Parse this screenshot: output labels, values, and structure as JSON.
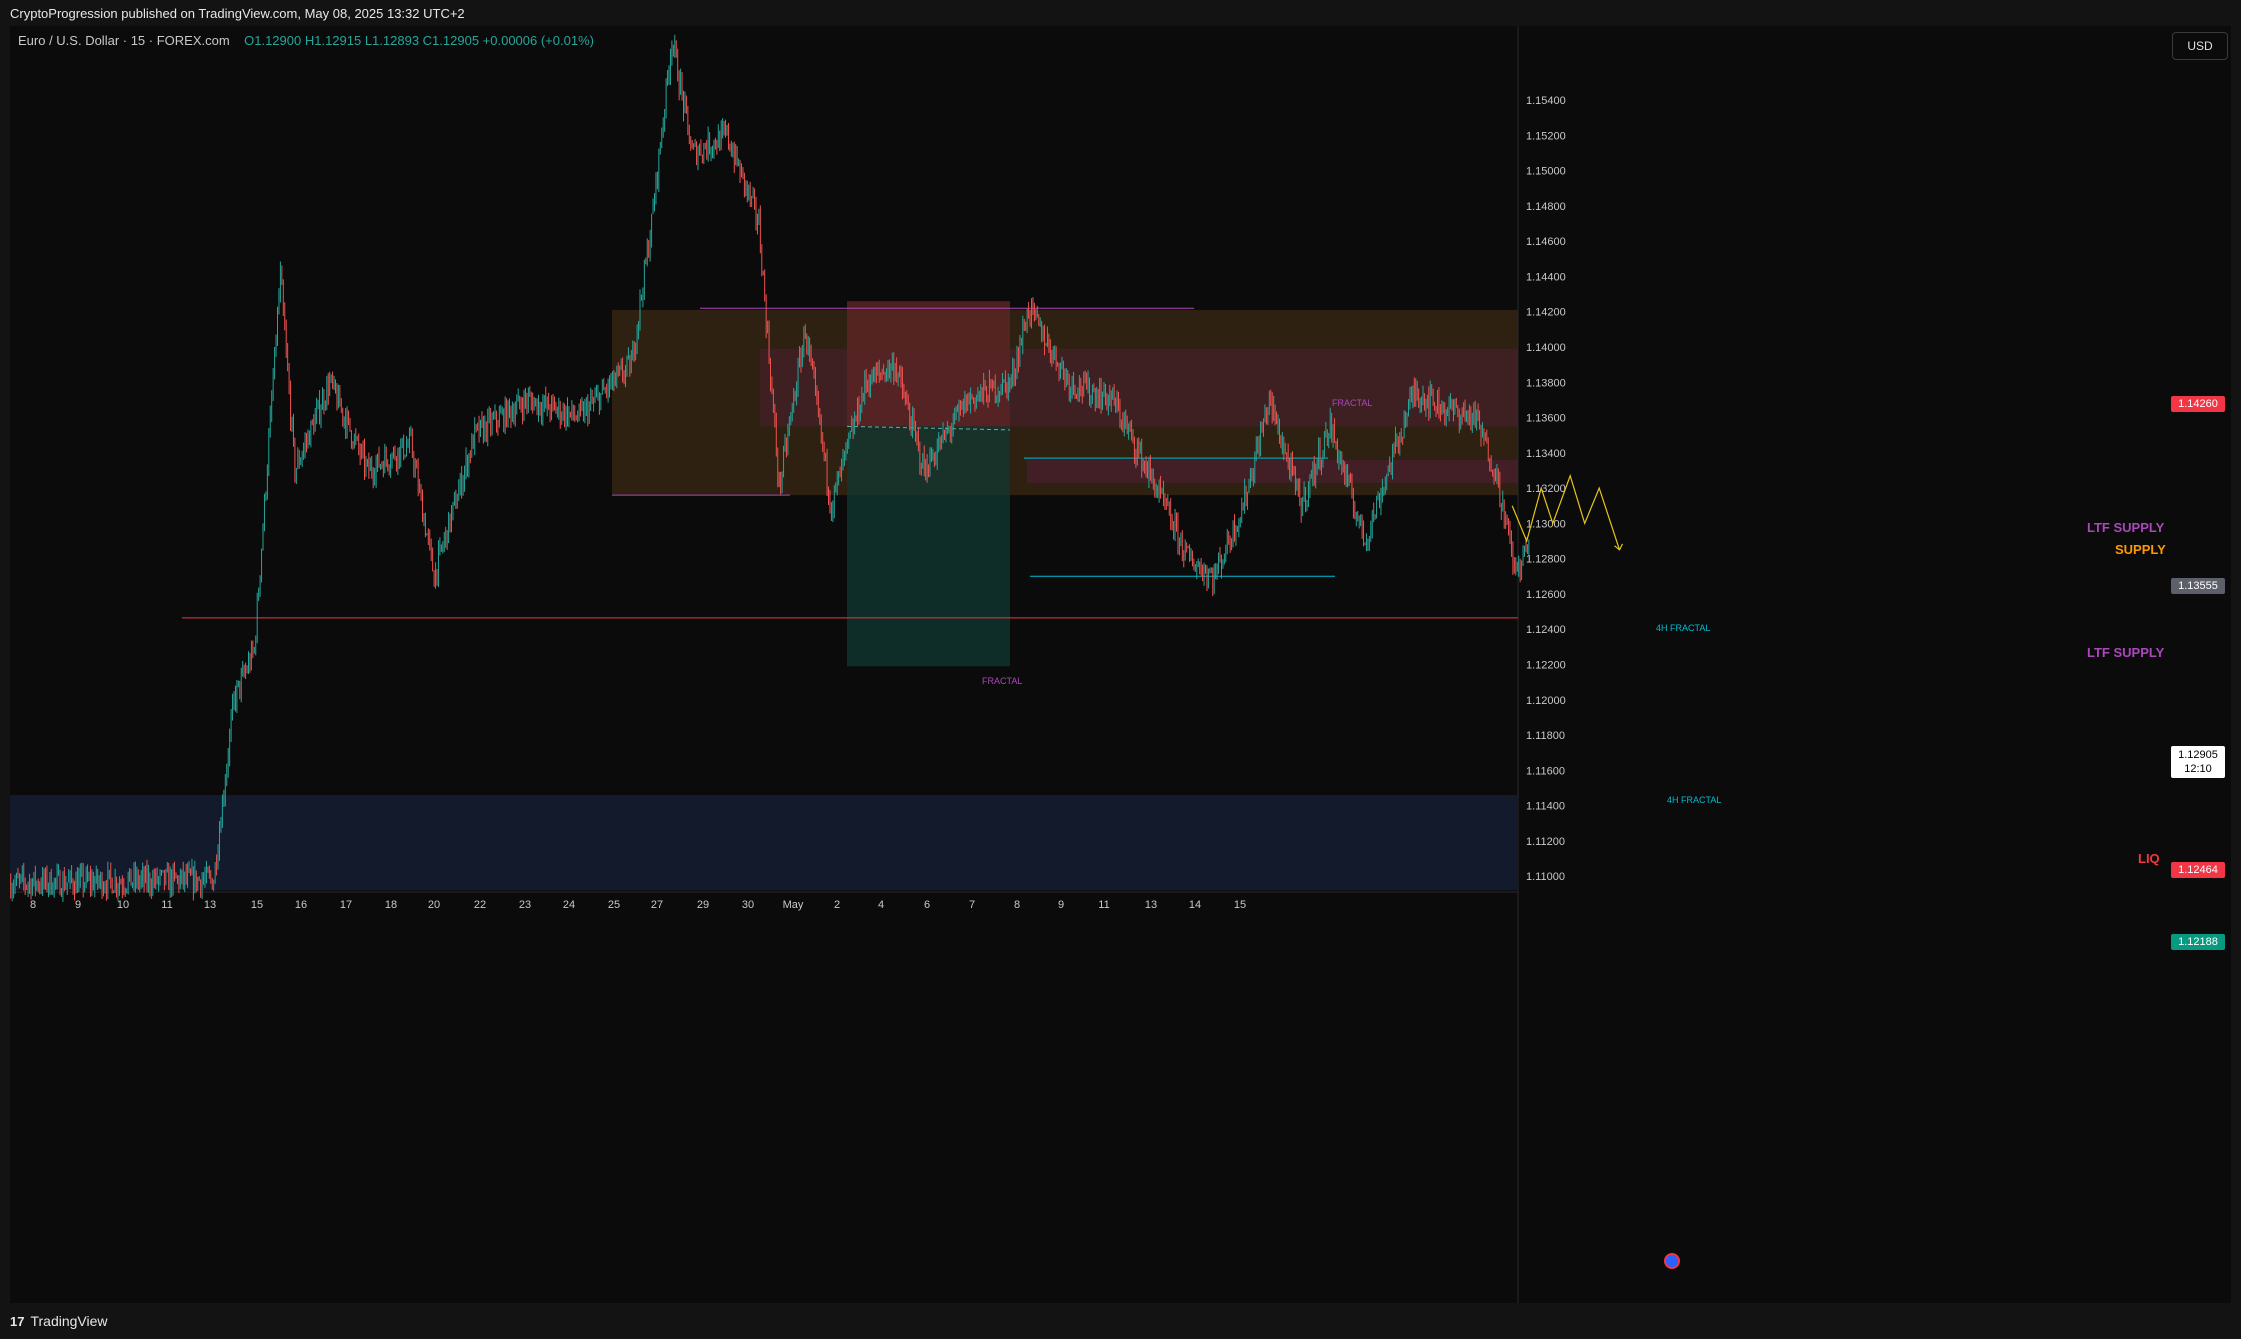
{
  "publish_bar": {
    "text": "CryptoProgression published on TradingView.com, May 08, 2025 13:32 UTC+2"
  },
  "symbol": {
    "name": "Euro / U.S. Dollar · 15 · FOREX.com",
    "ohlc": "O1.12900 H1.12915 L1.12893 C1.12905 +0.00006 (+0.01%)"
  },
  "currency_button": "USD",
  "footer": {
    "logo_text": "TradingView",
    "logo_icon": "tradingview-logo-icon"
  },
  "colors": {
    "up": "#26a69a",
    "down": "#ef5350",
    "liq": "#f23645",
    "fractal": "#ab47bc",
    "fractal_4h": "#00bcd4",
    "projection": "#e6c619",
    "supply": "#ff9800"
  },
  "annotations": {
    "ltf_supply_1": "LTF SUPPLY",
    "supply": "SUPPLY",
    "ltf_supply_2": "LTF SUPPLY",
    "liq": "LIQ",
    "fractal_top": "FRACTAL",
    "fractal_left": "FRACTAL",
    "fractal_4h_top": "4H FRACTAL",
    "fractal_4h_bottom": "4H FRACTAL"
  },
  "price_labels": {
    "top_red": "1.14260",
    "mid_gray": "1.13555",
    "last_price": "1.12905",
    "countdown": "12:10",
    "liq_red": "1.12464",
    "teal": "1.12188"
  },
  "chart_data": {
    "type": "candlestick",
    "title": "Euro / U.S. Dollar · 15 · FOREX.com",
    "y_ticks": [
      "1.15400",
      "1.15200",
      "1.15000",
      "1.14800",
      "1.14600",
      "1.14400",
      "1.14200",
      "1.14000",
      "1.13800",
      "1.13600",
      "1.13400",
      "1.13200",
      "1.13000",
      "1.12800",
      "1.12600",
      "1.12400",
      "1.12200",
      "1.12000",
      "1.11800",
      "1.11600",
      "1.11400",
      "1.11200",
      "1.11000"
    ],
    "ylim": [
      1.1091,
      1.1582
    ],
    "x_ticks": [
      "8",
      "9",
      "10",
      "11",
      "13",
      "15",
      "16",
      "17",
      "18",
      "20",
      "22",
      "23",
      "24",
      "25",
      "27",
      "29",
      "30",
      "May",
      "2",
      "4",
      "6",
      "7",
      "8",
      "9",
      "11",
      "13",
      "14",
      "15"
    ],
    "price_path_key_points": [
      [
        0,
        1.1096
      ],
      [
        140,
        1.1098
      ],
      [
        154,
        1.12
      ],
      [
        168,
        1.1228
      ],
      [
        186,
        1.144
      ],
      [
        196,
        1.133
      ],
      [
        220,
        1.138
      ],
      [
        246,
        1.133
      ],
      [
        276,
        1.1345
      ],
      [
        292,
        1.127
      ],
      [
        320,
        1.135
      ],
      [
        356,
        1.137
      ],
      [
        392,
        1.136
      ],
      [
        428,
        1.139
      ],
      [
        442,
        1.147
      ],
      [
        456,
        1.1575
      ],
      [
        470,
        1.151
      ],
      [
        494,
        1.152
      ],
      [
        516,
        1.147
      ],
      [
        530,
        1.132
      ],
      [
        548,
        1.141
      ],
      [
        566,
        1.131
      ],
      [
        590,
        1.138
      ],
      [
        610,
        1.139
      ],
      [
        630,
        1.133
      ],
      [
        660,
        1.137
      ],
      [
        690,
        1.138
      ],
      [
        702,
        1.1422
      ],
      [
        730,
        1.138
      ],
      [
        760,
        1.137
      ],
      [
        790,
        1.132
      ],
      [
        812,
        1.128
      ],
      [
        830,
        1.127
      ],
      [
        850,
        1.131
      ],
      [
        868,
        1.137
      ],
      [
        890,
        1.131
      ],
      [
        910,
        1.1355
      ],
      [
        934,
        1.129
      ],
      [
        968,
        1.1375
      ],
      [
        990,
        1.1365
      ],
      [
        1010,
        1.136
      ],
      [
        1024,
        1.133
      ],
      [
        1038,
        1.1272
      ],
      [
        1048,
        1.129
      ]
    ],
    "zones": [
      {
        "name": "supply",
        "y_top": 1.1421,
        "y_bottom": 1.1316
      },
      {
        "name": "ltf-supply-upper",
        "y_top": 1.1399,
        "y_bottom": 1.1355
      },
      {
        "name": "ltf-supply-lower",
        "y_top": 1.1336,
        "y_bottom": 1.1323
      },
      {
        "name": "position-stop",
        "y_top": 1.1426,
        "y_bottom": 1.1355
      },
      {
        "name": "position-target",
        "y_top": 1.1355,
        "y_bottom": 1.1219
      },
      {
        "name": "demand",
        "y_top": 1.1146,
        "y_bottom": 1.1092
      }
    ],
    "levels": [
      {
        "name": "fractal-top",
        "value": 1.1422
      },
      {
        "name": "fractal-left",
        "value": 1.1316
      },
      {
        "name": "4h-fractal-top",
        "value": 1.1337
      },
      {
        "name": "4h-fractal-bottom",
        "value": 1.127
      },
      {
        "name": "liq",
        "value": 1.12464
      }
    ],
    "projection_path": [
      [
        1036,
        1.131
      ],
      [
        1046,
        1.129
      ],
      [
        1056,
        1.132
      ],
      [
        1064,
        1.13
      ],
      [
        1076,
        1.1327
      ],
      [
        1086,
        1.13
      ],
      [
        1096,
        1.132
      ],
      [
        1110,
        1.1285
      ]
    ]
  }
}
